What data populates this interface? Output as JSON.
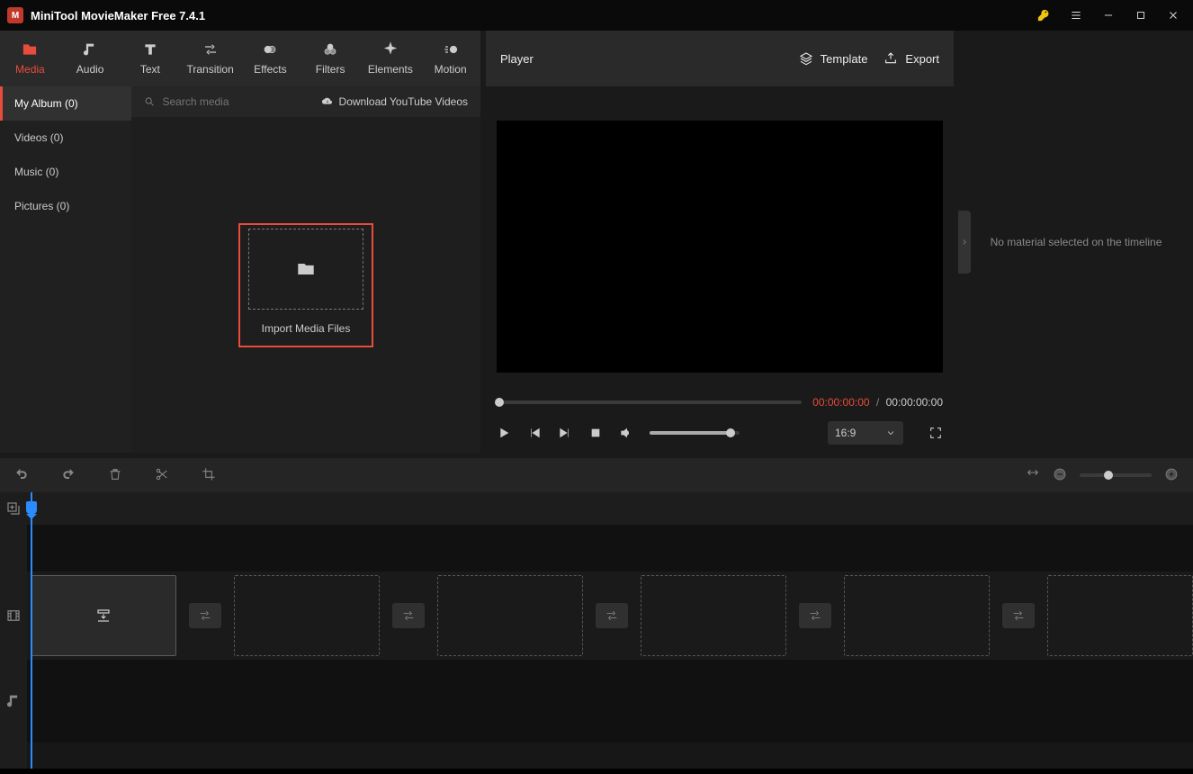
{
  "app_title": "MiniTool MovieMaker Free 7.4.1",
  "tool_tabs": [
    "Media",
    "Audio",
    "Text",
    "Transition",
    "Effects",
    "Filters",
    "Elements",
    "Motion"
  ],
  "sidebar": {
    "items": [
      {
        "label": "My Album (0)"
      },
      {
        "label": "Videos (0)"
      },
      {
        "label": "Music (0)"
      },
      {
        "label": "Pictures (0)"
      }
    ]
  },
  "search_placeholder": "Search media",
  "download_yt": "Download YouTube Videos",
  "import_label": "Import Media Files",
  "player": {
    "title": "Player",
    "template": "Template",
    "export": "Export",
    "time_current": "00:00:00:00",
    "time_sep": "/",
    "time_total": "00:00:00:00",
    "ratio": "16:9"
  },
  "inspector": {
    "message": "No material selected on the timeline"
  }
}
